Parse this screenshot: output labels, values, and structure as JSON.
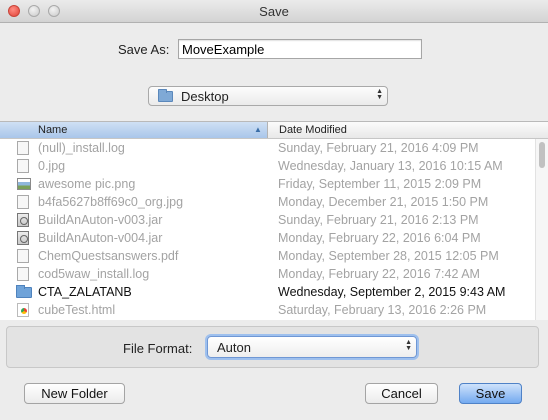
{
  "window": {
    "title": "Save"
  },
  "save_as": {
    "label": "Save As:",
    "value": "MoveExample"
  },
  "location": {
    "selected": "Desktop",
    "icon": "folder-icon"
  },
  "file_list": {
    "columns": {
      "name": "Name",
      "date": "Date Modified",
      "sort": "ascending by name"
    },
    "rows": [
      {
        "name": "(null)_install.log",
        "date": "Sunday, February 21, 2016 4:09 PM",
        "icon": "document-icon",
        "enabled": false
      },
      {
        "name": "0.jpg",
        "date": "Wednesday, January 13, 2016 10:15 AM",
        "icon": "document-icon",
        "enabled": false
      },
      {
        "name": "awesome pic.png",
        "date": "Friday, September 11, 2015 2:09 PM",
        "icon": "image-icon",
        "enabled": false
      },
      {
        "name": "b4fa5627b8ff69c0_org.jpg",
        "date": "Monday, December 21, 2015 1:50 PM",
        "icon": "document-icon",
        "enabled": false
      },
      {
        "name": "BuildAnAuton-v003.jar",
        "date": "Sunday, February 21, 2016 2:13 PM",
        "icon": "jar-icon",
        "enabled": false
      },
      {
        "name": "BuildAnAuton-v004.jar",
        "date": "Monday, February 22, 2016 6:04 PM",
        "icon": "jar-icon",
        "enabled": false
      },
      {
        "name": "ChemQuestsanswers.pdf",
        "date": "Monday, September 28, 2015 12:05 PM",
        "icon": "document-icon",
        "enabled": false
      },
      {
        "name": "cod5waw_install.log",
        "date": "Monday, February 22, 2016 7:42 AM",
        "icon": "document-icon",
        "enabled": false
      },
      {
        "name": "CTA_ZALATANB",
        "date": "Wednesday, September 2, 2015 9:43 AM",
        "icon": "folder-icon",
        "enabled": true
      },
      {
        "name": "cubeTest.html",
        "date": "Saturday, February 13, 2016 2:26 PM",
        "icon": "html-icon",
        "enabled": false
      }
    ]
  },
  "file_format": {
    "label": "File Format:",
    "selected": "Auton"
  },
  "buttons": {
    "new_folder": "New Folder",
    "cancel": "Cancel",
    "save": "Save"
  }
}
